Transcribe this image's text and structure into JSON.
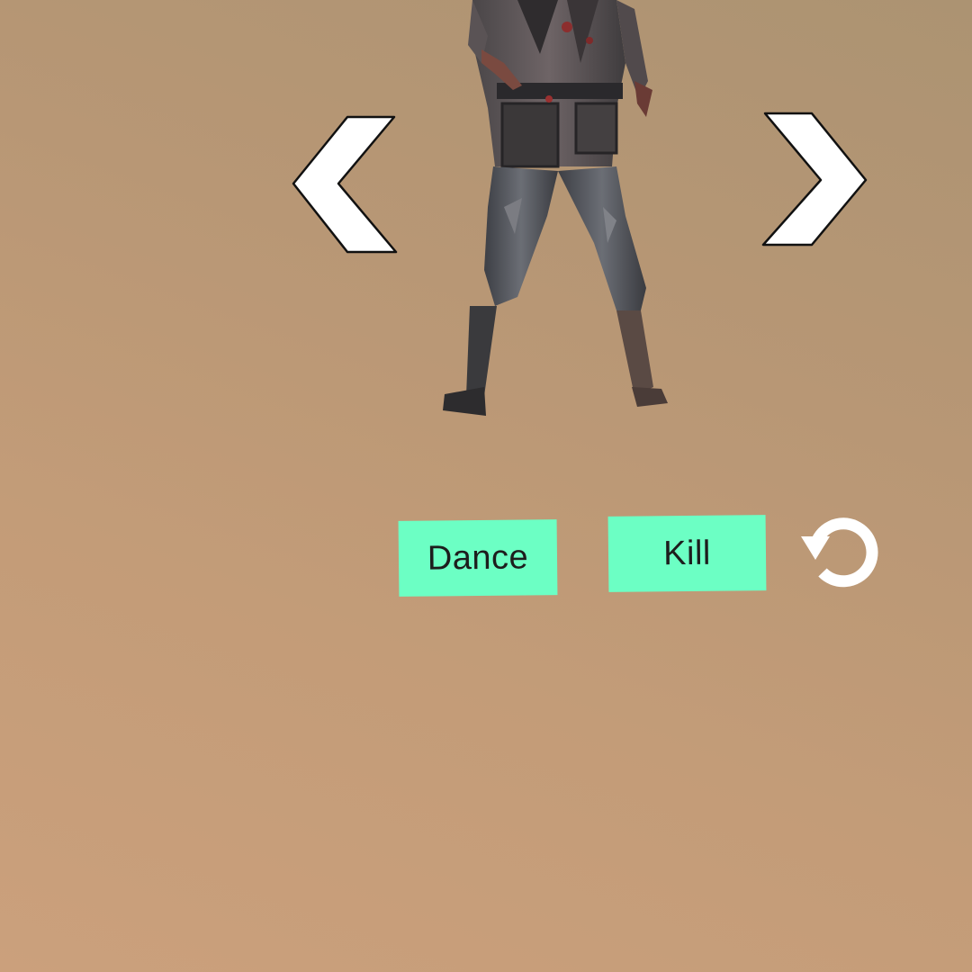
{
  "scene": {
    "character_icon": "zombie-character"
  },
  "navigation": {
    "previous_icon": "chevron-left-icon",
    "next_icon": "chevron-right-icon"
  },
  "actions": {
    "dance_label": "Dance",
    "kill_label": "Kill",
    "reset_icon": "reset-icon",
    "button_color": "#6cffc4"
  }
}
